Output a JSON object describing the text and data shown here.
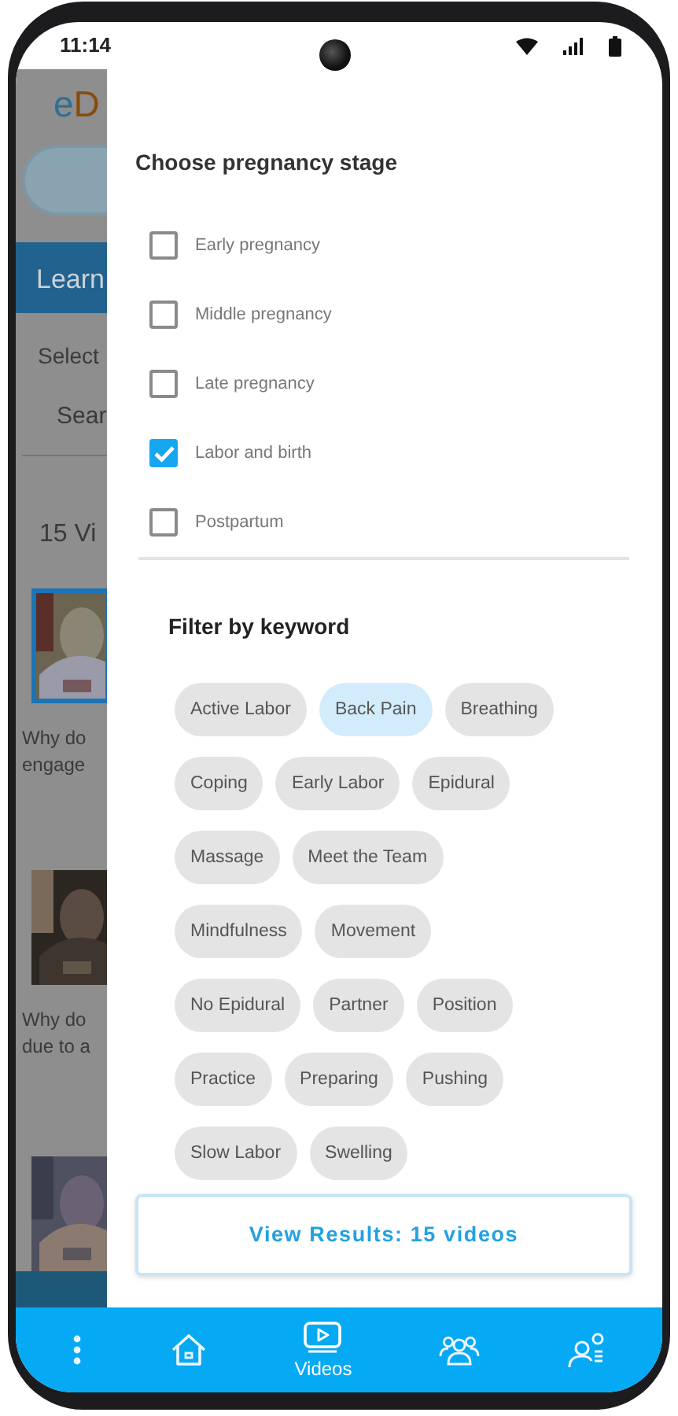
{
  "status_bar": {
    "time": "11:14"
  },
  "background_screen": {
    "logo": [
      "e",
      "D"
    ],
    "banner": "Learn",
    "select_label": "Select",
    "search_placeholder": "Sear",
    "count": "15 Vi",
    "videos": [
      {
        "selected": true,
        "lines": [
          "Why do",
          "engage"
        ]
      },
      {
        "selected": false,
        "lines": [
          "Why do",
          "due to a"
        ]
      },
      {
        "selected": false
      }
    ]
  },
  "filter_drawer": {
    "stage_title": "Choose pregnancy stage",
    "stages": [
      {
        "label": "Early pregnancy",
        "checked": false
      },
      {
        "label": "Middle pregnancy",
        "checked": false
      },
      {
        "label": "Late pregnancy",
        "checked": false
      },
      {
        "label": "Labor and birth",
        "checked": true
      },
      {
        "label": "Postpartum",
        "checked": false
      }
    ],
    "keyword_title": "Filter by keyword",
    "keywords": [
      {
        "label": "Active Labor",
        "selected": false
      },
      {
        "label": "Back Pain",
        "selected": true
      },
      {
        "label": "Breathing",
        "selected": false
      },
      {
        "label": "Coping",
        "selected": false
      },
      {
        "label": "Early Labor",
        "selected": false
      },
      {
        "label": "Epidural",
        "selected": false
      },
      {
        "label": "Massage",
        "selected": false
      },
      {
        "label": "Meet the Team",
        "selected": false
      },
      {
        "label": "Mindfulness",
        "selected": false
      },
      {
        "label": "Movement",
        "selected": false
      },
      {
        "label": "No Epidural",
        "selected": false
      },
      {
        "label": "Partner",
        "selected": false
      },
      {
        "label": "Position",
        "selected": false
      },
      {
        "label": "Practice",
        "selected": false
      },
      {
        "label": "Preparing",
        "selected": false
      },
      {
        "label": "Pushing",
        "selected": false
      },
      {
        "label": "Slow Labor",
        "selected": false
      },
      {
        "label": "Swelling",
        "selected": false
      }
    ],
    "results_button": "View Results: 15 videos"
  },
  "bottom_nav": [
    {
      "kind": "menu",
      "selected": false
    },
    {
      "kind": "home",
      "selected": false
    },
    {
      "kind": "videos",
      "selected": true,
      "label": "Videos"
    },
    {
      "kind": "community",
      "selected": false
    },
    {
      "kind": "profile",
      "selected": false
    }
  ]
}
